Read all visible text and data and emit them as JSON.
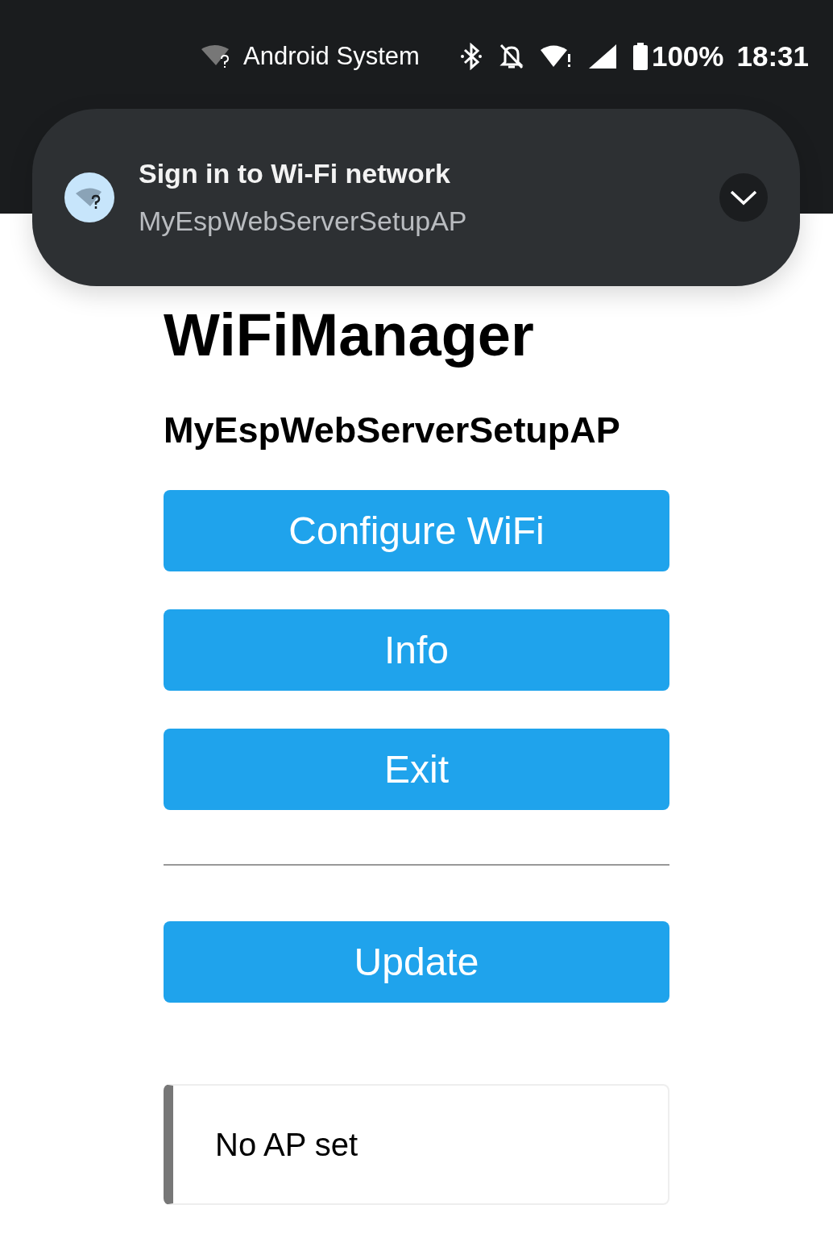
{
  "status_bar": {
    "notification_source": "Android System",
    "battery": "100%",
    "time": "18:31"
  },
  "notification": {
    "title": "Sign in to Wi-Fi network",
    "text": "MyEspWebServerSetupAP"
  },
  "page": {
    "title": "WiFiManager",
    "subtitle": "MyEspWebServerSetupAP",
    "buttons": [
      {
        "label": "Configure WiFi"
      },
      {
        "label": "Info"
      },
      {
        "label": "Exit"
      }
    ],
    "update_button": {
      "label": "Update"
    },
    "message": "No AP set"
  }
}
